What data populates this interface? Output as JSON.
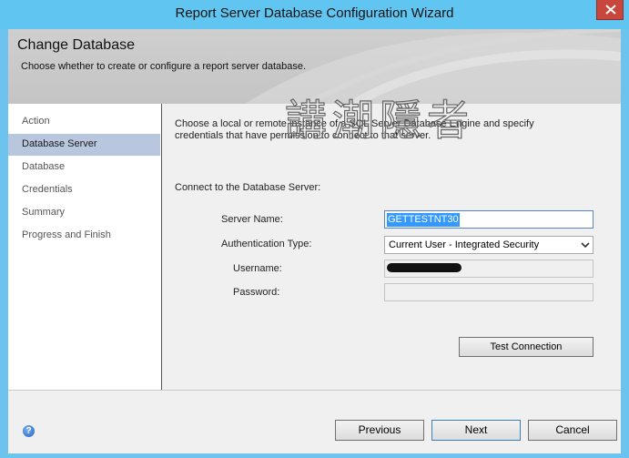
{
  "window": {
    "title": "Report Server Database Configuration Wizard"
  },
  "header": {
    "title": "Change Database",
    "subtitle": "Choose whether to create or configure a report server database."
  },
  "watermark": {
    "text": "講潮隱者"
  },
  "nav": {
    "items": [
      {
        "label": "Action"
      },
      {
        "label": "Database Server"
      },
      {
        "label": "Database"
      },
      {
        "label": "Credentials"
      },
      {
        "label": "Summary"
      },
      {
        "label": "Progress and Finish"
      }
    ],
    "active": "Database Server"
  },
  "content": {
    "description": "Choose a local or remote instance of a SQL Server Database Engine and specify credentials that have permission to connect to that server.",
    "section_label": "Connect to the Database Server:",
    "server_name": {
      "label": "Server Name:",
      "value": "GETTESTNT30"
    },
    "auth_type": {
      "label": "Authentication Type:",
      "value": "Current User - Integrated Security"
    },
    "username": {
      "label": "Username:",
      "value": ""
    },
    "password": {
      "label": "Password:",
      "value": ""
    },
    "test_button": "Test Connection"
  },
  "footer": {
    "previous": "Previous",
    "next": "Next",
    "cancel": "Cancel"
  },
  "colors": {
    "titlebar": "#60c6f1",
    "close": "#c9463d",
    "nav_active": "#b8c7dd",
    "selection": "#3399ff"
  },
  "icons": {
    "close": "close-icon",
    "help": "help-icon",
    "dropdown": "chevron-down-icon"
  }
}
